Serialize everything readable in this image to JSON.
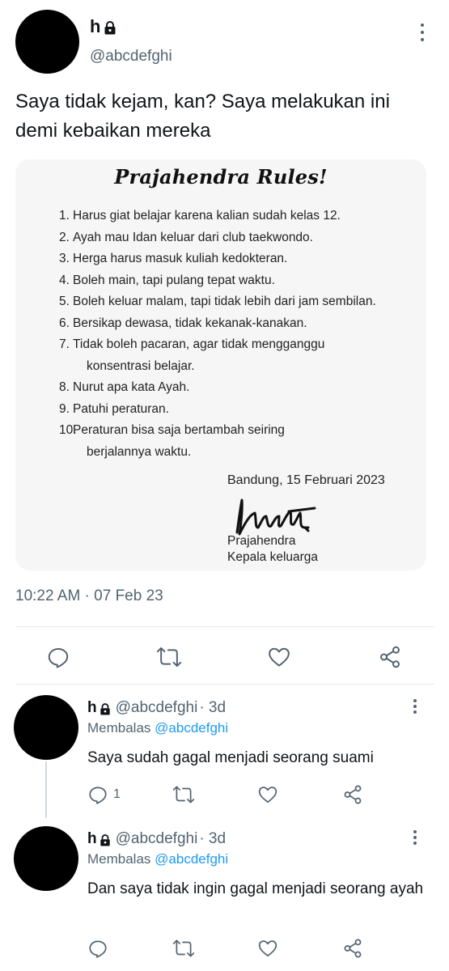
{
  "main_tweet": {
    "name": "h",
    "handle": "@abcdefghi",
    "text": "Saya tidak kejam, kan? Saya melakukan ini demi kebaikan mereka",
    "timestamp": "10:22 AM · 07 Feb 23"
  },
  "card": {
    "title": "Prajahendra Rules!",
    "rules": [
      {
        "num": "1.",
        "text": "Harus giat belajar karena kalian sudah kelas 12.",
        "cont": ""
      },
      {
        "num": "2.",
        "text": "Ayah mau Idan keluar dari club taekwondo.",
        "cont": ""
      },
      {
        "num": "3.",
        "text": "Herga harus masuk kuliah kedokteran.",
        "cont": ""
      },
      {
        "num": "4.",
        "text": "Boleh main, tapi pulang tepat waktu.",
        "cont": ""
      },
      {
        "num": "5.",
        "text": "Boleh keluar malam, tapi tidak lebih dari jam sembilan.",
        "cont": ""
      },
      {
        "num": "6.",
        "text": "Bersikap dewasa, tidak kekanak-kanakan.",
        "cont": ""
      },
      {
        "num": "7.",
        "text": "Tidak boleh pacaran, agar tidak mengganggu",
        "cont": "konsentrasi belajar."
      },
      {
        "num": "8.",
        "text": "Nurut apa kata Ayah.",
        "cont": ""
      },
      {
        "num": "9.",
        "text": "Patuhi peraturan.",
        "cont": ""
      },
      {
        "num": "10.",
        "text": "Peraturan bisa saja bertambah seiring",
        "cont": "berjalannya waktu."
      }
    ],
    "place_date": "Bandung, 15 Februari 2023",
    "signer_name": "Prajahendra",
    "signer_role": "Kepala keluarga"
  },
  "icons": {
    "reply": "reply-icon",
    "retweet": "retweet-icon",
    "like": "heart-icon",
    "share": "share-icon",
    "more": "more-vertical-icon",
    "lock": "lock-icon"
  },
  "colors": {
    "text": "#0f1419",
    "secondary": "#536471",
    "link": "#1d9bf0",
    "card_bg": "#f6f6f6"
  },
  "replies": [
    {
      "name": "h",
      "handle": "@abcdefghi",
      "age": "· 3d",
      "replying_label": "Membalas",
      "replying_to": "@abcdefghi",
      "text": "Saya sudah gagal menjadi seorang suami",
      "reply_count": "1"
    },
    {
      "name": "h",
      "handle": "@abcdefghi",
      "age": "· 3d",
      "replying_label": "Membalas",
      "replying_to": "@abcdefghi",
      "text": "Dan saya tidak ingin gagal menjadi seorang ayah",
      "reply_count": ""
    }
  ]
}
